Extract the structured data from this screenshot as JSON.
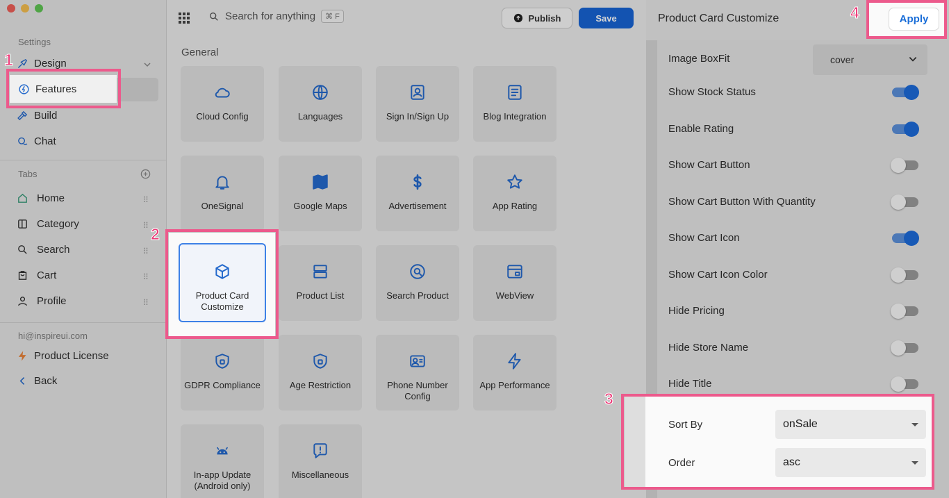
{
  "sidebar": {
    "settings_title": "Settings",
    "items": [
      {
        "label": "Design",
        "icon": "brush-icon"
      },
      {
        "label": "Features",
        "icon": "lightning-circle-icon"
      },
      {
        "label": "Build",
        "icon": "hammer-icon"
      },
      {
        "label": "Chat",
        "icon": "chat-icon"
      }
    ],
    "tabs_title": "Tabs",
    "tabs": [
      {
        "label": "Home",
        "icon": "home-icon"
      },
      {
        "label": "Category",
        "icon": "category-icon"
      },
      {
        "label": "Search",
        "icon": "search-icon"
      },
      {
        "label": "Cart",
        "icon": "cart-icon"
      },
      {
        "label": "Profile",
        "icon": "profile-icon"
      }
    ],
    "email": "hi@inspireui.com",
    "license": "Product License",
    "back": "Back"
  },
  "topbar": {
    "search_placeholder": "Search for anything",
    "shortcut": "⌘ F",
    "publish": "Publish",
    "save": "Save"
  },
  "main": {
    "group_title": "General",
    "cards": [
      {
        "label": "Cloud Config",
        "icon": "cloud-icon"
      },
      {
        "label": "Languages",
        "icon": "globe-icon"
      },
      {
        "label": "Sign In/Sign Up",
        "icon": "id-card-icon"
      },
      {
        "label": "Blog Integration",
        "icon": "article-icon"
      },
      {
        "label": "OneSignal",
        "icon": "bell-icon"
      },
      {
        "label": "Google Maps",
        "icon": "map-icon"
      },
      {
        "label": "Advertisement",
        "icon": "dollar-icon"
      },
      {
        "label": "App Rating",
        "icon": "star-icon"
      },
      {
        "label": "Product Card Customize",
        "icon": "cube-icon"
      },
      {
        "label": "Product List",
        "icon": "list-icon"
      },
      {
        "label": "Search Product",
        "icon": "search-circle-icon"
      },
      {
        "label": "WebView",
        "icon": "browser-icon"
      },
      {
        "label": "GDPR Compliance",
        "icon": "shield-lock-icon"
      },
      {
        "label": "Age Restriction",
        "icon": "shield-lock-icon"
      },
      {
        "label": "Phone Number Config",
        "icon": "contact-card-icon"
      },
      {
        "label": "App Performance",
        "icon": "lightning-icon"
      },
      {
        "label": "In-app Update (Android only)",
        "icon": "android-icon"
      },
      {
        "label": "Miscellaneous",
        "icon": "alert-message-icon"
      }
    ]
  },
  "panel": {
    "title": "Product Card Customize",
    "apply": "Apply",
    "image_boxfit_label": "Image BoxFit",
    "image_boxfit_value": "cover",
    "toggles": [
      {
        "label": "Show Stock Status",
        "on": true
      },
      {
        "label": "Enable Rating",
        "on": true
      },
      {
        "label": "Show Cart Button",
        "on": false
      },
      {
        "label": "Show Cart Button With Quantity",
        "on": false
      },
      {
        "label": "Show Cart Icon",
        "on": true
      },
      {
        "label": "Show Cart Icon Color",
        "on": false
      },
      {
        "label": "Hide Pricing",
        "on": false
      },
      {
        "label": "Hide Store Name",
        "on": false
      },
      {
        "label": "Hide Title",
        "on": false
      }
    ],
    "sort_by_label": "Sort By",
    "sort_by_value": "onSale",
    "order_label": "Order",
    "order_value": "asc"
  },
  "callouts": [
    "1",
    "2",
    "3",
    "4"
  ],
  "colors": {
    "accent": "#1764d3",
    "highlight": "#ec5a8c",
    "toggle_on": "#1c6ad9"
  }
}
